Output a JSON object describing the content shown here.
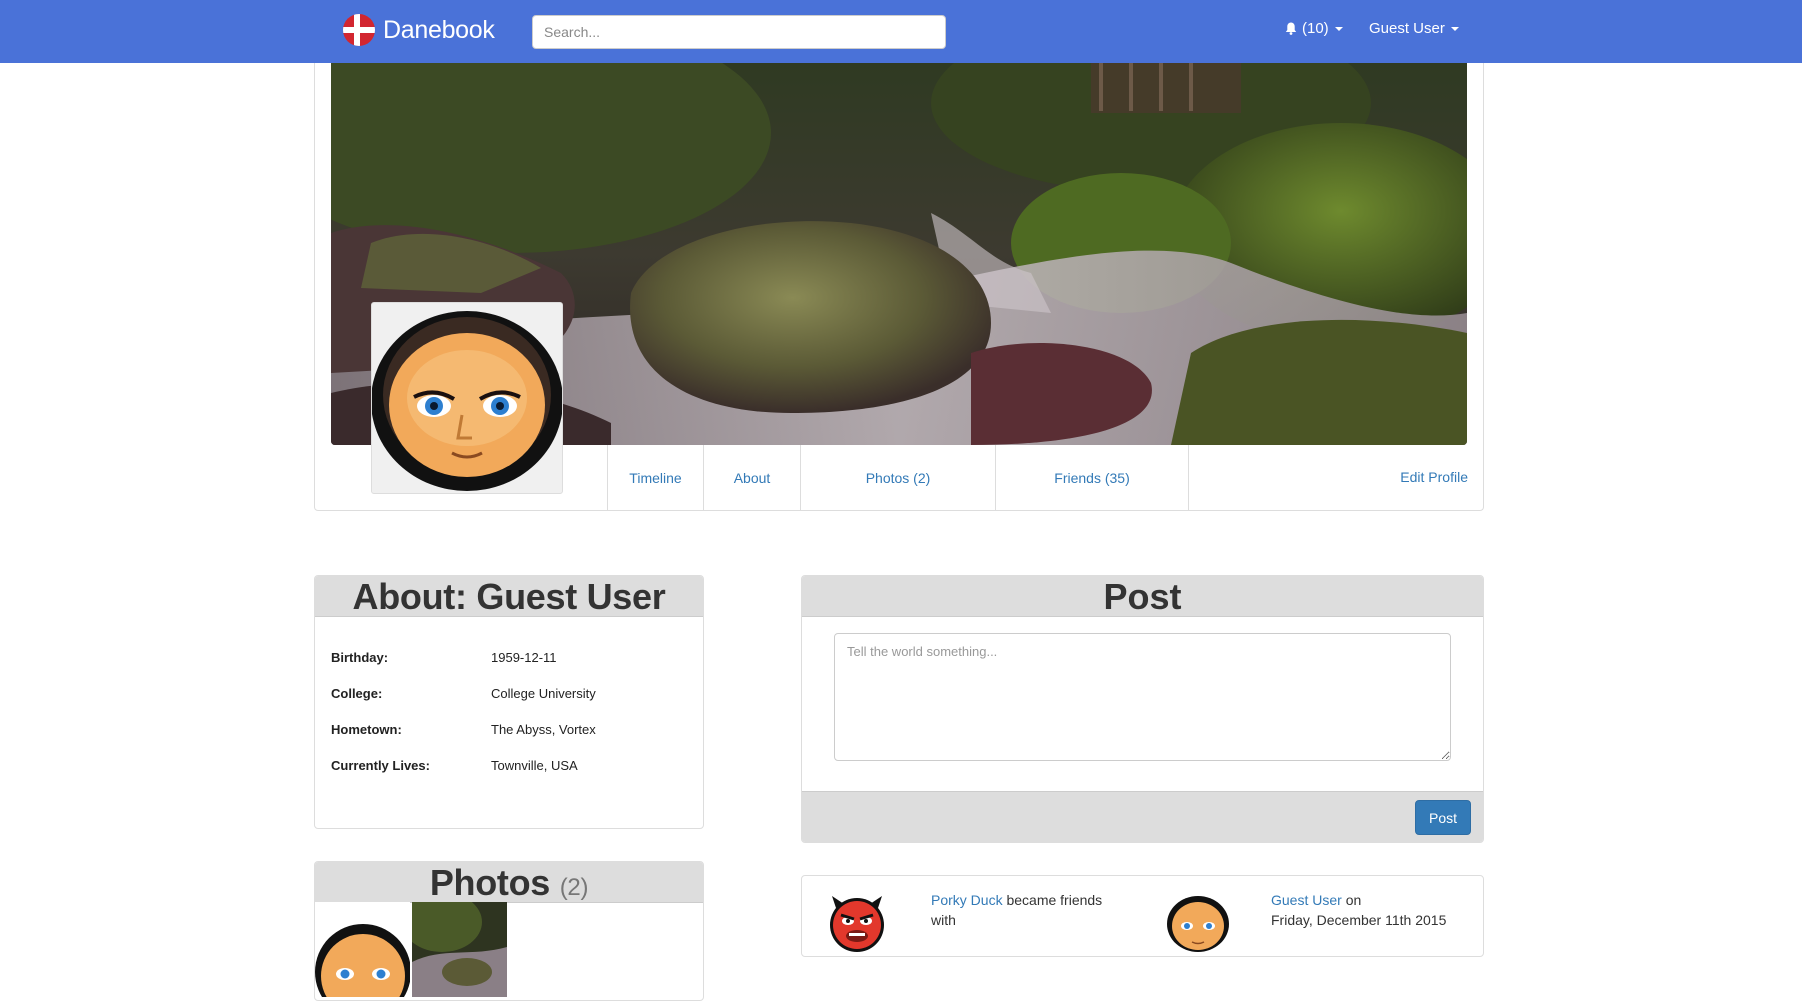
{
  "navbar": {
    "brand": "Danebook",
    "search_placeholder": "Search...",
    "notifications": "(10)",
    "user_menu": "Guest User"
  },
  "profile": {
    "tabs": [
      {
        "label": "Timeline"
      },
      {
        "label": "About"
      },
      {
        "label": "Photos (2)"
      },
      {
        "label": "Friends (35)"
      }
    ],
    "edit_profile": "Edit Profile"
  },
  "about": {
    "title": "About: Guest User",
    "rows": [
      {
        "key": "Birthday:",
        "value": "1959-12-11"
      },
      {
        "key": "College:",
        "value": "College University"
      },
      {
        "key": "Hometown:",
        "value": "The Abyss, Vortex"
      },
      {
        "key": "Currently Lives:",
        "value": "Townville, USA"
      }
    ]
  },
  "photos": {
    "title": "Photos",
    "count": "(2)"
  },
  "post": {
    "title": "Post",
    "placeholder": "Tell the world something...",
    "button": "Post"
  },
  "activity": {
    "friend_name": "Porky Duck",
    "became_friends": " became friends with",
    "user_name": "Guest User",
    "on_text": " on",
    "date": "Friday, December 11th 2015"
  },
  "colors": {
    "navbar": "#4a72d8",
    "link": "#337ab7",
    "panel_heading": "#dddddd"
  }
}
